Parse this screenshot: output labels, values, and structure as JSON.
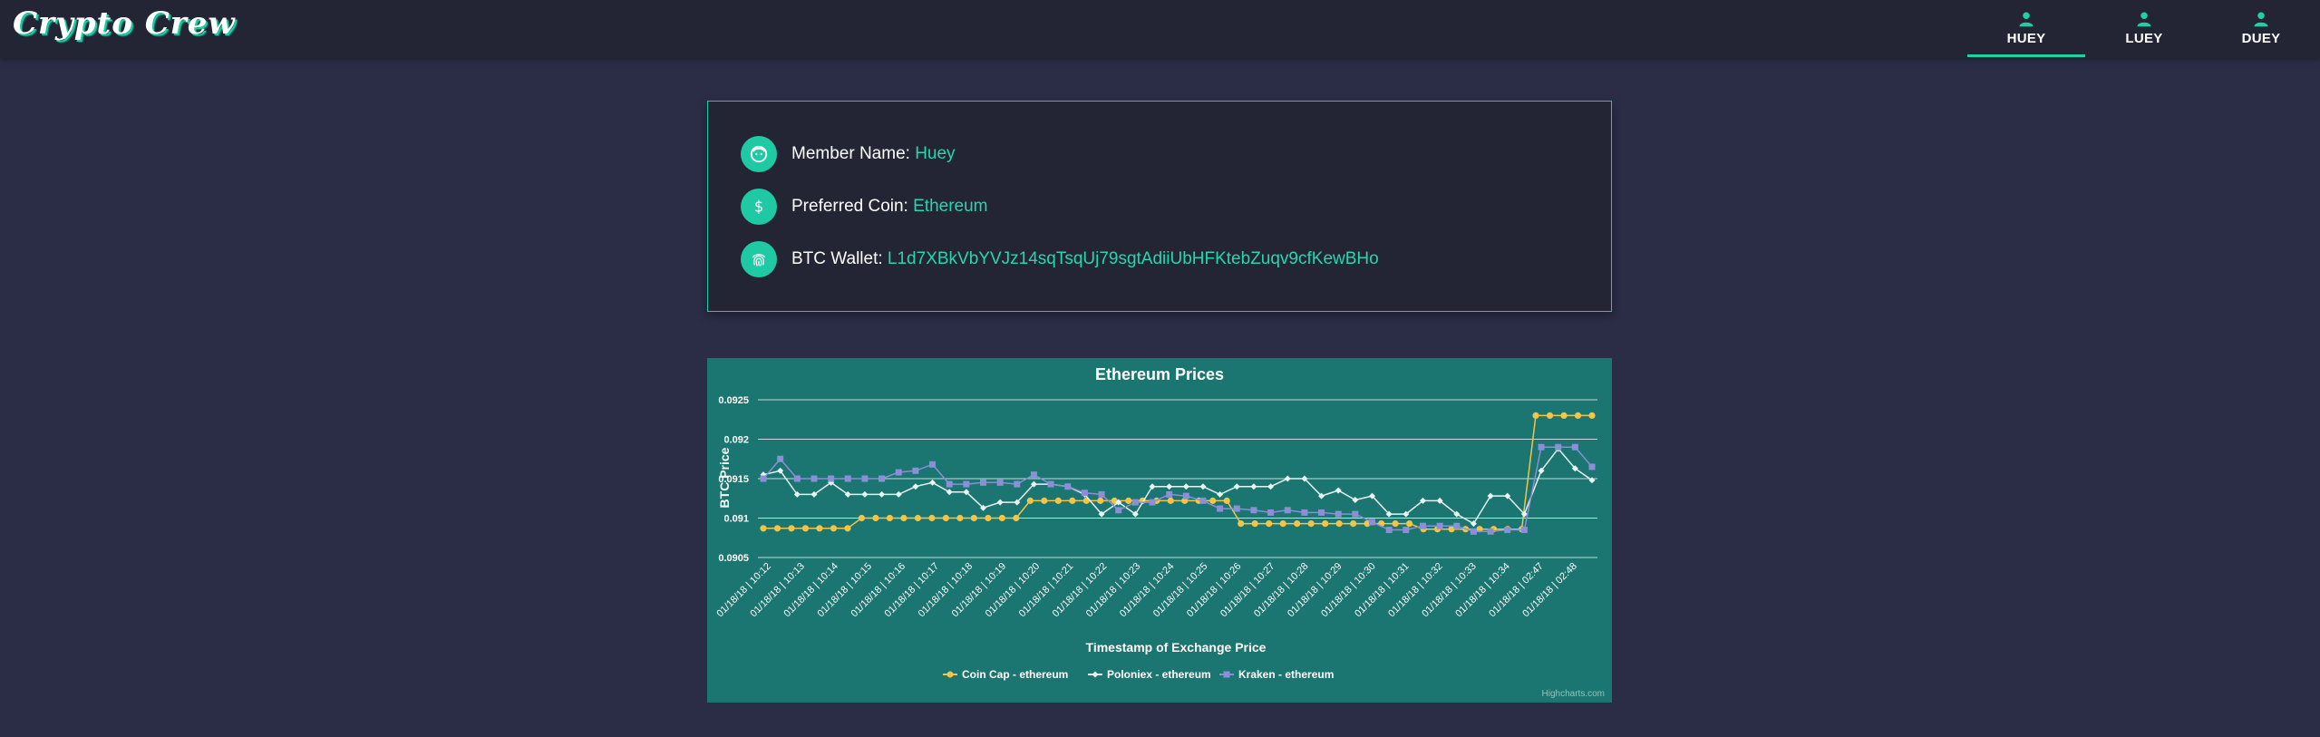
{
  "app": {
    "logo_text": "Crypto Crew"
  },
  "nav": {
    "tabs": [
      {
        "label": "HUEY",
        "icon": "user-icon",
        "active": true
      },
      {
        "label": "LUEY",
        "icon": "user-icon",
        "active": false
      },
      {
        "label": "DUEY",
        "icon": "user-icon",
        "active": false
      }
    ]
  },
  "profile": {
    "name_label": "Member Name:",
    "name_value": "Huey",
    "name_icon": "face-icon",
    "coin_label": "Preferred Coin:",
    "coin_value": "Ethereum",
    "coin_icon": "dollar-icon",
    "wallet_label": "BTC Wallet:",
    "wallet_value": "L1d7XBkVbYVJz14sqTsqUj79sgtAdiiUbHFKtebZuqv9cfKewBHo",
    "wallet_icon": "fingerprint-icon"
  },
  "colors": {
    "accent": "#1fc9a4",
    "chart_bg": "#1b7571",
    "coin_cap": "#f2c548",
    "poloniex": "#e8f4f4",
    "kraken": "#8a8fd6"
  },
  "chart_data": {
    "type": "line",
    "title": "Ethereum Prices",
    "xlabel": "Timestamp of Exchange Price",
    "ylabel": "BTC Price",
    "ylim": [
      0.0905,
      0.0925
    ],
    "yticks": [
      "0.0905",
      "0.091",
      "0.0915",
      "0.092",
      "0.0925"
    ],
    "x_tick_labels": [
      "01/18/18 | 10:12",
      "01/18/18 | 10:13",
      "01/18/18 | 10:14",
      "01/18/18 | 10:15",
      "01/18/18 | 10:16",
      "01/18/18 | 10:17",
      "01/18/18 | 10:18",
      "01/18/18 | 10:19",
      "01/18/18 | 10:20",
      "01/18/18 | 10:21",
      "01/18/18 | 10:22",
      "01/18/18 | 10:23",
      "01/18/18 | 10:24",
      "01/18/18 | 10:25",
      "01/18/18 | 10:26",
      "01/18/18 | 10:27",
      "01/18/18 | 10:28",
      "01/18/18 | 10:29",
      "01/18/18 | 10:30",
      "01/18/18 | 10:31",
      "01/18/18 | 10:32",
      "01/18/18 | 10:33",
      "01/18/18 | 10:34",
      "01/18/18 | 02:47",
      "01/18/18 | 02:48"
    ],
    "legend_position": "bottom-center",
    "grid": true,
    "credits": "Highcharts.com",
    "series": [
      {
        "name": "Coin Cap - ethereum",
        "marker": "circle",
        "values": [
          0.09087,
          0.09087,
          0.09087,
          0.09087,
          0.09087,
          0.09087,
          0.09087,
          0.091,
          0.091,
          0.091,
          0.091,
          0.091,
          0.091,
          0.091,
          0.091,
          0.091,
          0.091,
          0.091,
          0.091,
          0.09122,
          0.09122,
          0.09122,
          0.09122,
          0.09122,
          0.09122,
          0.09122,
          0.09122,
          0.09122,
          0.09122,
          0.09122,
          0.09122,
          0.09122,
          0.09122,
          0.09122,
          0.09093,
          0.09093,
          0.09093,
          0.09093,
          0.09093,
          0.09093,
          0.09093,
          0.09093,
          0.09093,
          0.09093,
          0.09093,
          0.09093,
          0.09093,
          0.09086,
          0.09086,
          0.09086,
          0.09086,
          0.09086,
          0.09086,
          0.09086,
          0.09086,
          0.0923,
          0.0923,
          0.0923,
          0.0923,
          0.0923
        ]
      },
      {
        "name": "Poloniex - ethereum",
        "marker": "diamond",
        "values": [
          0.09155,
          0.0916,
          0.0913,
          0.0913,
          0.09145,
          0.0913,
          0.0913,
          0.0913,
          0.0913,
          0.0914,
          0.09145,
          0.09133,
          0.09133,
          0.09113,
          0.0912,
          0.0912,
          0.09143,
          0.09143,
          0.0914,
          0.0913,
          0.09105,
          0.0912,
          0.09105,
          0.0914,
          0.0914,
          0.0914,
          0.0914,
          0.0913,
          0.0914,
          0.0914,
          0.0914,
          0.0915,
          0.0915,
          0.09128,
          0.09135,
          0.09123,
          0.09128,
          0.09105,
          0.09105,
          0.09122,
          0.09122,
          0.09105,
          0.09093,
          0.09128,
          0.09128,
          0.09105,
          0.0916,
          0.09188,
          0.09163,
          0.09148
        ]
      },
      {
        "name": "Kraken - ethereum",
        "marker": "square",
        "values": [
          0.0915,
          0.09175,
          0.0915,
          0.0915,
          0.0915,
          0.0915,
          0.0915,
          0.0915,
          0.09158,
          0.0916,
          0.09168,
          0.09143,
          0.09143,
          0.09145,
          0.09145,
          0.09143,
          0.09155,
          0.09143,
          0.0914,
          0.09132,
          0.0913,
          0.0911,
          0.0912,
          0.0912,
          0.0913,
          0.09128,
          0.09122,
          0.09112,
          0.09112,
          0.0911,
          0.09107,
          0.0911,
          0.09107,
          0.09107,
          0.09105,
          0.09105,
          0.09095,
          0.09085,
          0.09085,
          0.0909,
          0.0909,
          0.0909,
          0.09083,
          0.09083,
          0.09085,
          0.09085,
          0.0919,
          0.0919,
          0.0919,
          0.09165
        ]
      }
    ]
  }
}
